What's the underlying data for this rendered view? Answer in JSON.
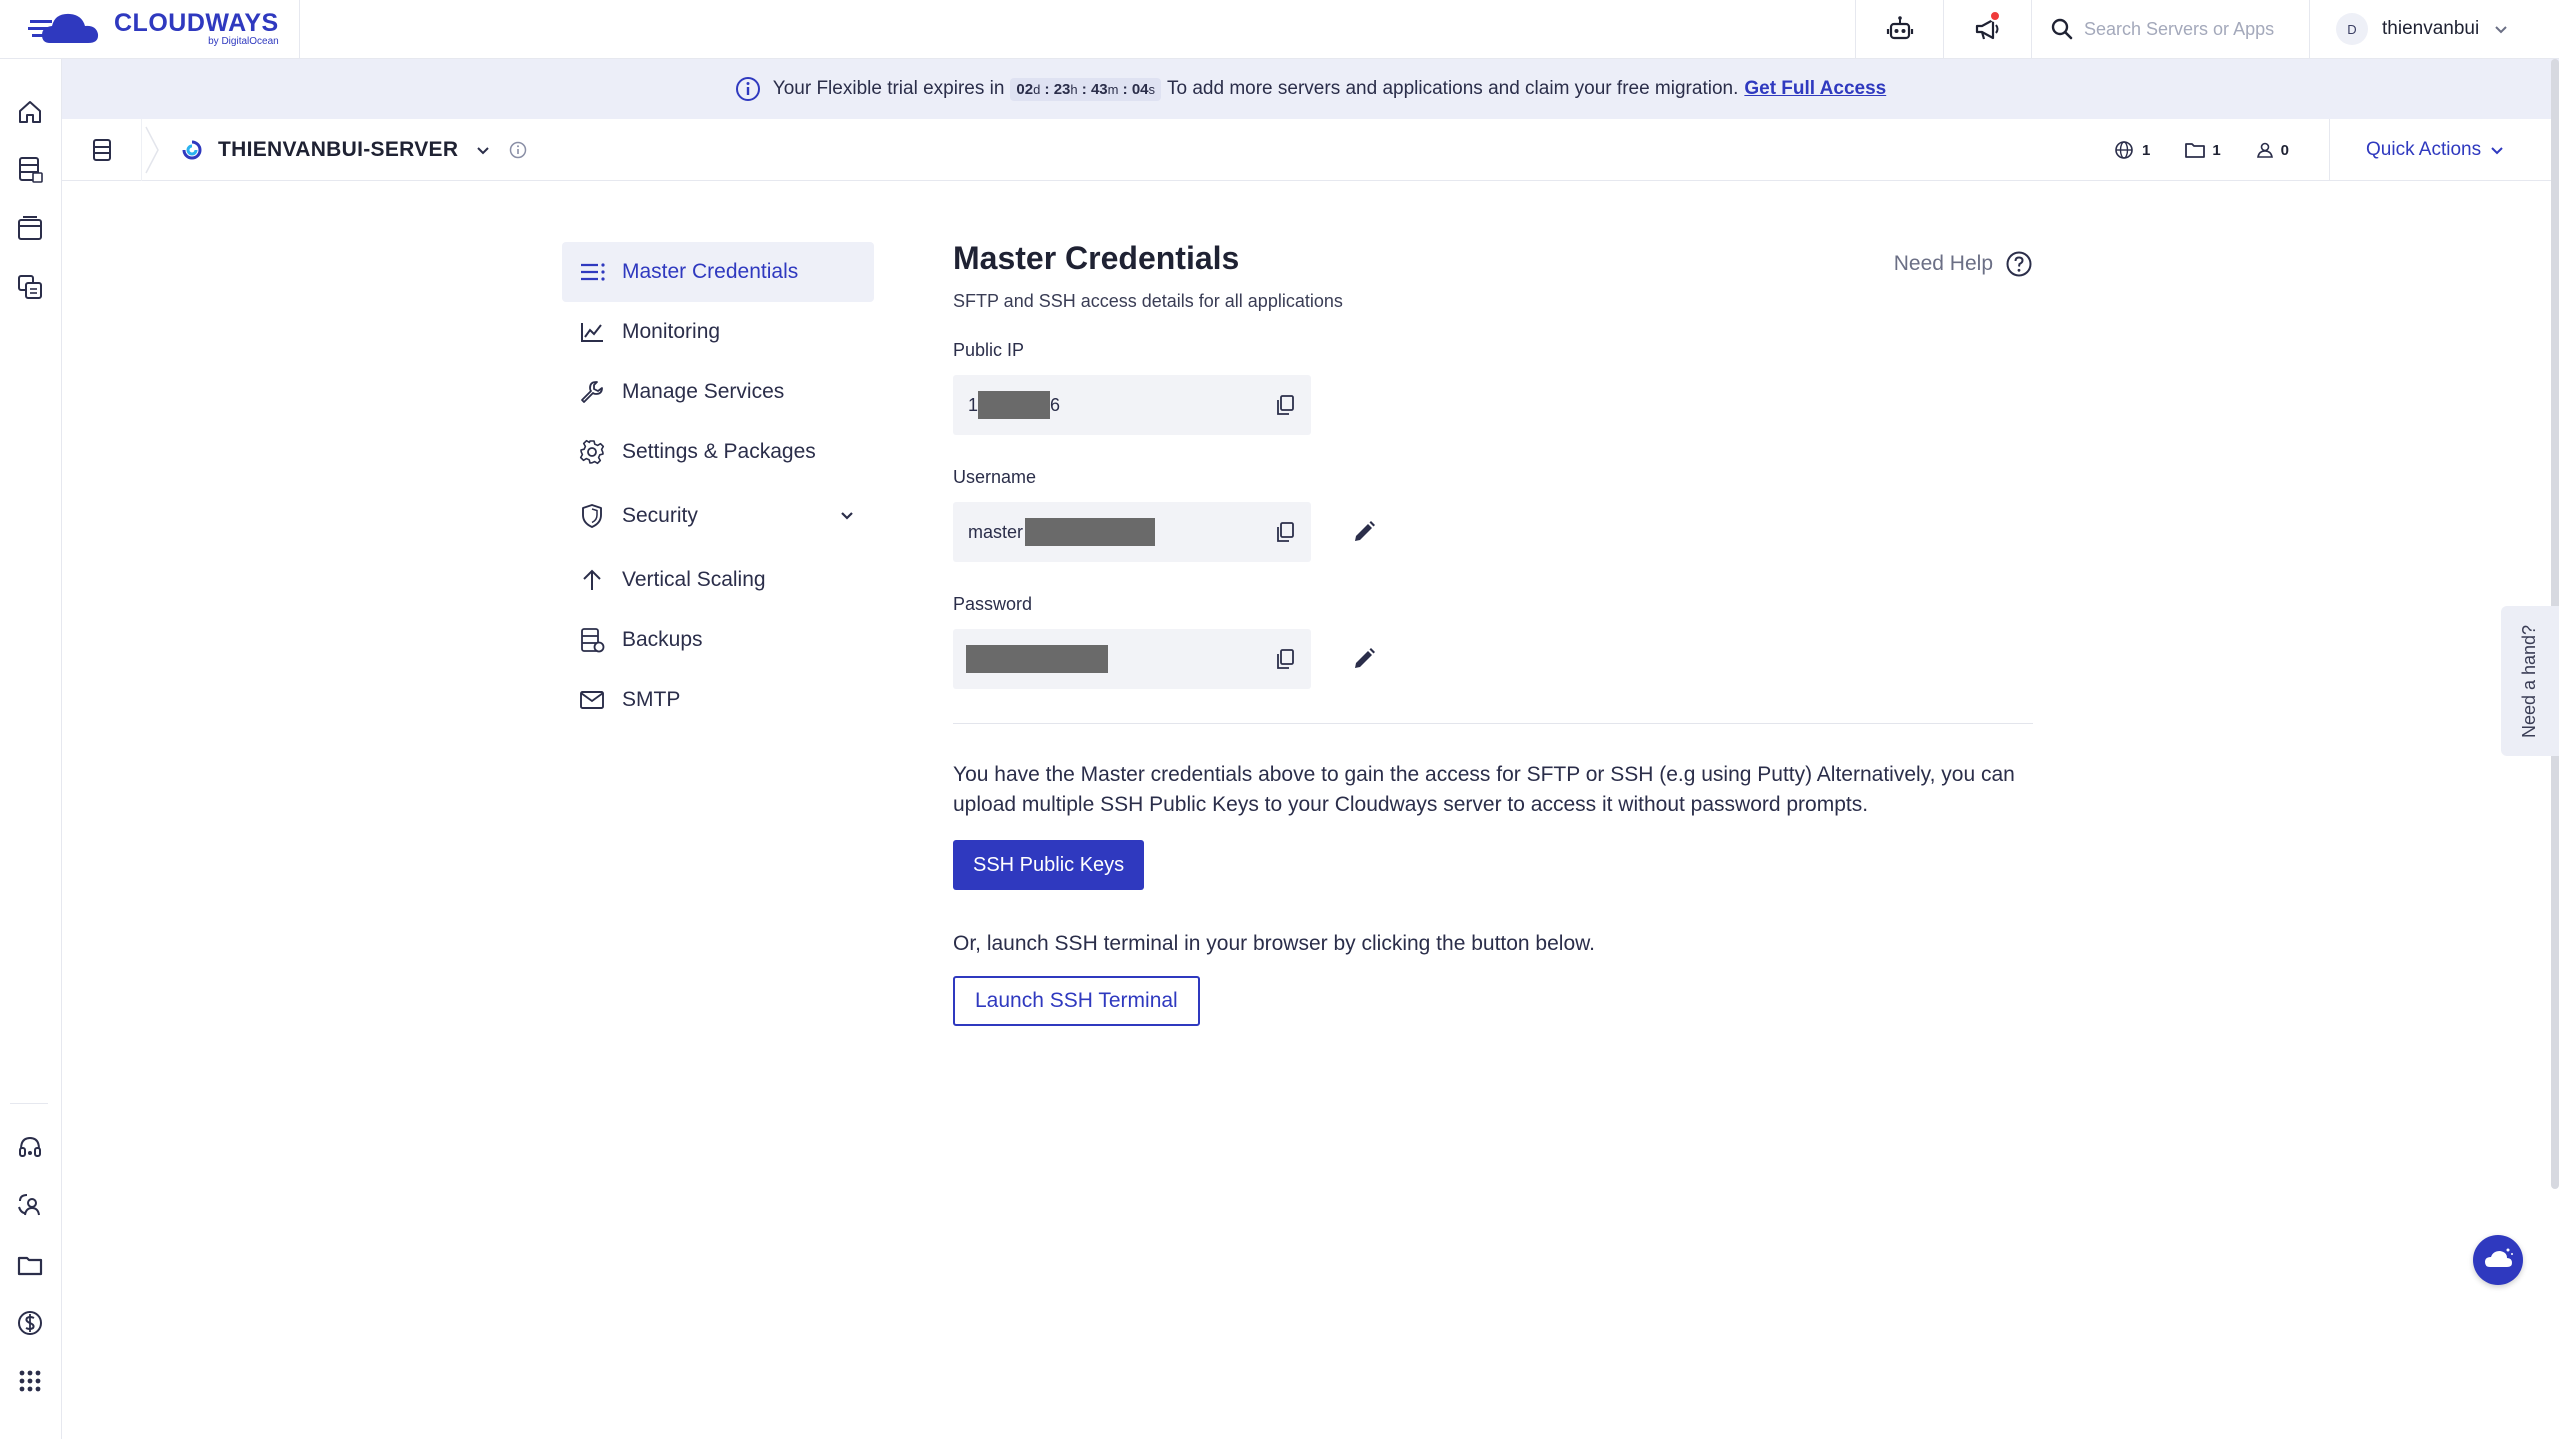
{
  "brand": {
    "name": "CLOUDWAYS",
    "sub": "by DigitalOcean"
  },
  "topbar": {
    "search_placeholder": "Search Servers or Apps",
    "user_initial": "D",
    "user_name": "thienvanbui"
  },
  "banner": {
    "prefix": "Your Flexible trial expires in",
    "days": "02",
    "days_unit": "d",
    "hours": "23",
    "hours_unit": "h",
    "minutes": "43",
    "minutes_unit": "m",
    "seconds": "04",
    "seconds_unit": "s",
    "suffix": "To add more servers and applications and claim your free migration.",
    "link": "Get Full Access"
  },
  "server": {
    "name": "THIENVANBUI-SERVER",
    "www_count": "1",
    "folder_count": "1",
    "user_count": "0",
    "quick_actions": "Quick Actions"
  },
  "menu": {
    "items": [
      {
        "label": "Master Credentials",
        "icon": "list-icon"
      },
      {
        "label": "Monitoring",
        "icon": "chart-line-icon"
      },
      {
        "label": "Manage Services",
        "icon": "wrench-icon"
      },
      {
        "label": "Settings & Packages",
        "icon": "gear-icon"
      },
      {
        "label": "Security",
        "icon": "shield-icon"
      },
      {
        "label": "Vertical Scaling",
        "icon": "arrow-up-icon"
      },
      {
        "label": "Backups",
        "icon": "backup-icon"
      },
      {
        "label": "SMTP",
        "icon": "mail-icon"
      }
    ]
  },
  "main": {
    "title": "Master Credentials",
    "subtitle": "SFTP and SSH access details for all applications",
    "help": "Need Help",
    "public_ip_label": "Public IP",
    "public_ip_prefix": "1",
    "public_ip_suffix": "6",
    "username_label": "Username",
    "username_prefix": "master",
    "password_label": "Password",
    "description": "You have the Master credentials above to gain the access for SFTP or SSH (e.g using Putty) Alternatively, you can upload multiple SSH Public Keys to your Cloudways server to access it without password prompts.",
    "ssh_keys_button": "SSH Public Keys",
    "or_text": "Or, launch SSH terminal in your browser by clicking the button below.",
    "launch_button": "Launch SSH Terminal"
  },
  "side_tab": "Need a hand?",
  "colors": {
    "accent": "#2f39bf",
    "banner_bg": "#eceef8",
    "notification": "#ef3b3b"
  }
}
